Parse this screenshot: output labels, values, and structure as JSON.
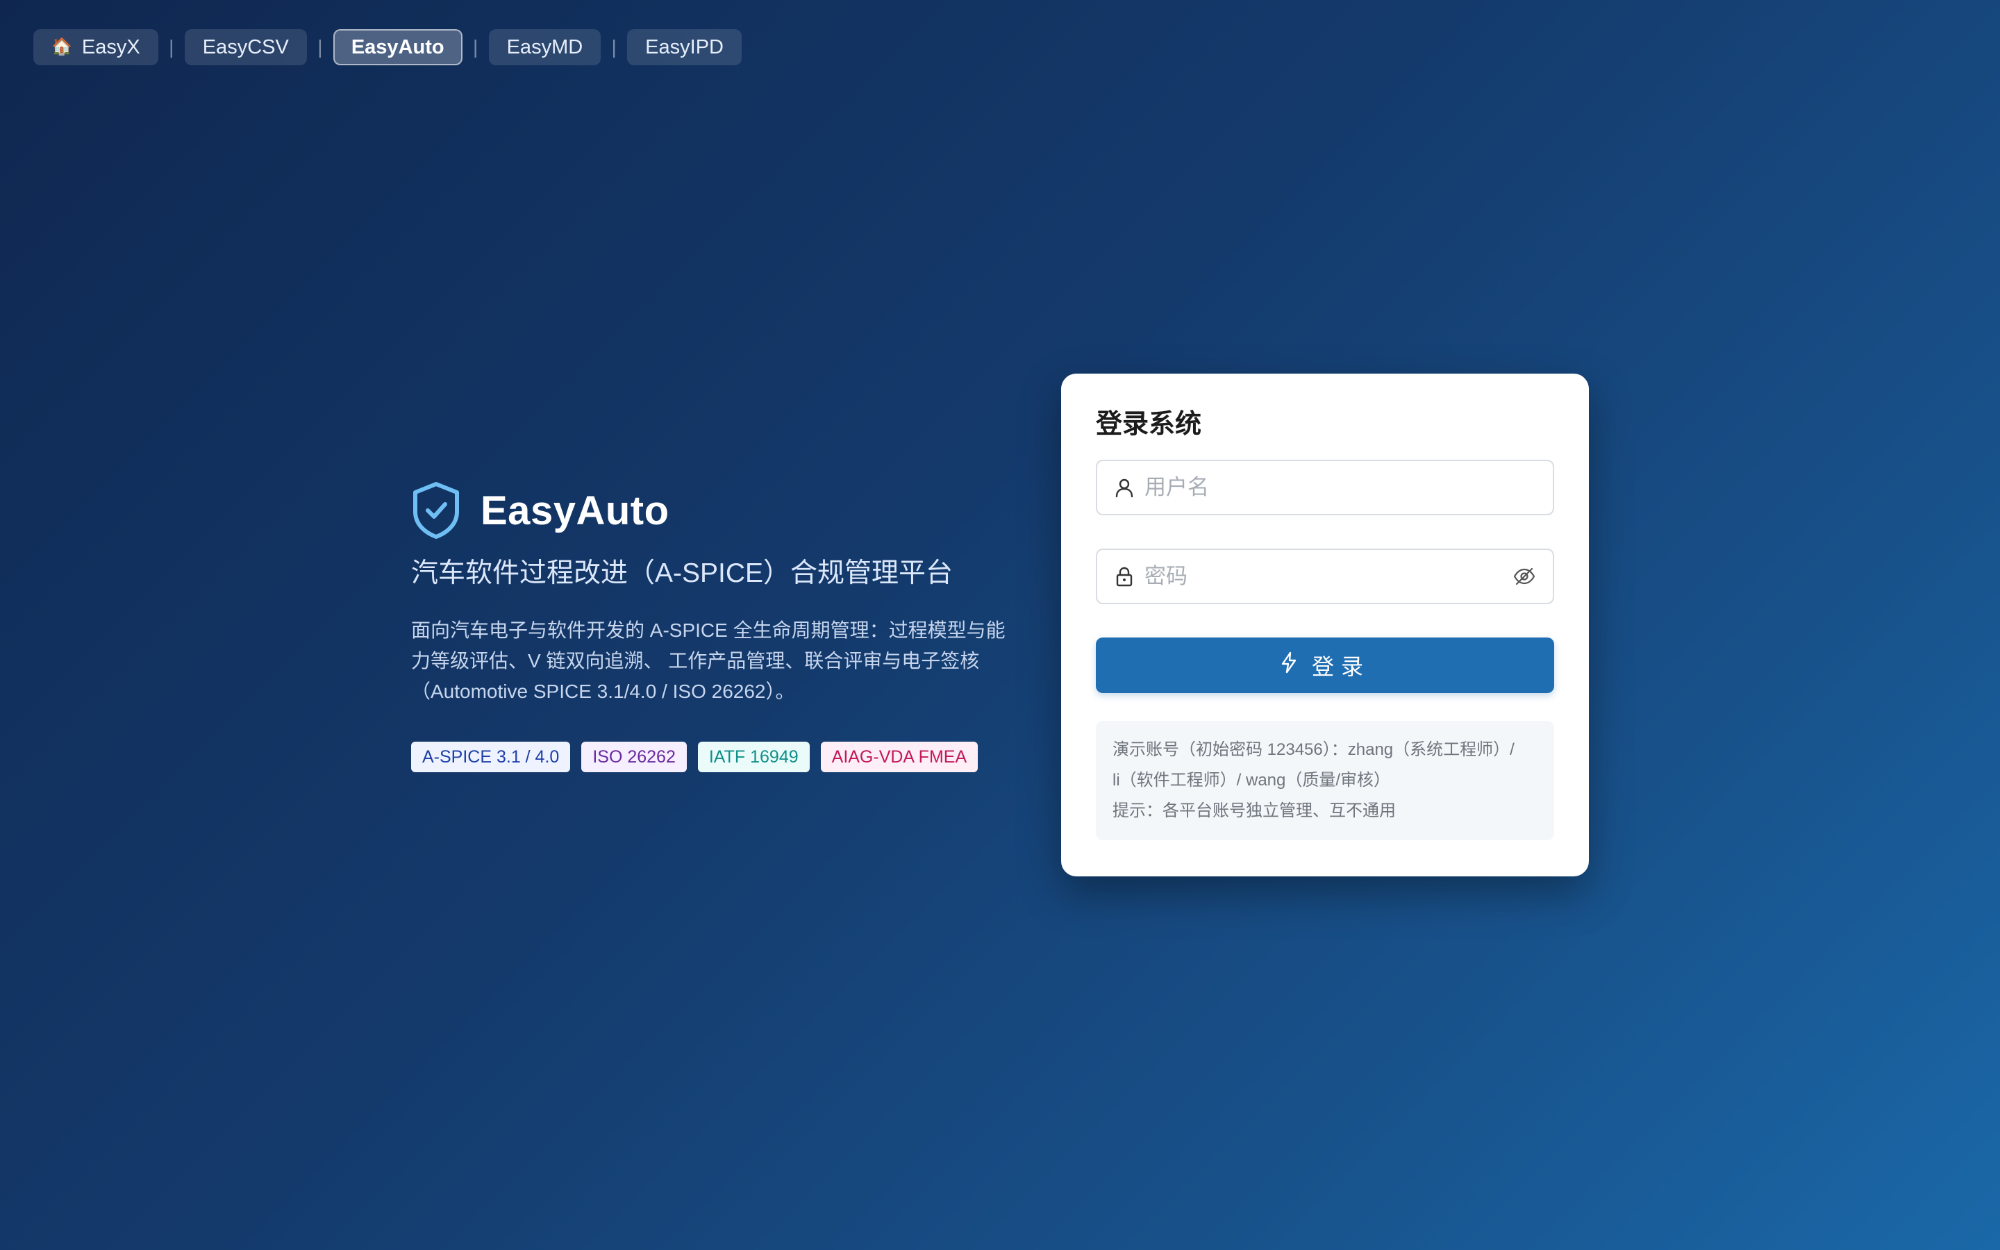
{
  "nav": {
    "tabs": [
      {
        "label": "EasyX",
        "icon": "home-icon"
      },
      {
        "label": "EasyCSV"
      },
      {
        "label": "EasyAuto",
        "active": true
      },
      {
        "label": "EasyMD"
      },
      {
        "label": "EasyIPD"
      }
    ],
    "separator": "|"
  },
  "hero": {
    "brand_name": "EasyAuto",
    "brand_icon": "shield-check-icon",
    "subtitle": "汽车软件过程改进（A-SPICE）合规管理平台",
    "description": "面向汽车电子与软件开发的 A-SPICE 全生命周期管理：过程模型与能力等级评估、V 链双向追溯、 工作产品管理、联合评审与电子签核（Automotive SPICE 3.1/4.0 / ISO 26262）。",
    "tags": [
      {
        "label": "A-SPICE 3.1 / 4.0",
        "color": "#1e3fa8",
        "bg": "#eef3ff"
      },
      {
        "label": "ISO 26262",
        "color": "#6a2aa0",
        "bg": "#f6efff"
      },
      {
        "label": "IATF 16949",
        "color": "#0f8f8a",
        "bg": "#eafbf9"
      },
      {
        "label": "AIAG-VDA FMEA",
        "color": "#c2185b",
        "bg": "#fdeff5"
      }
    ]
  },
  "login": {
    "title": "登录系统",
    "username_placeholder": "用户名",
    "password_placeholder": "密码",
    "submit_label": "登录",
    "hint_line1": "演示账号（初始密码 123456）：zhang（系统工程师）/",
    "hint_line2": "li（软件工程师）/ wang（质量/审核）",
    "hint_line3": "提示：各平台账号独立管理、互不通用"
  },
  "colors": {
    "primary": "#1f6eb2",
    "bg_start": "#0f2750",
    "bg_end": "#1a68a8"
  }
}
